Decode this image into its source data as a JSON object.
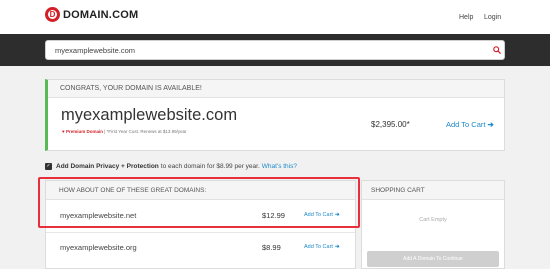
{
  "brand": {
    "logo_letter": "D",
    "name": "DOMAIN.COM",
    "accent": "#d32027"
  },
  "nav": {
    "help": "Help",
    "login": "Login"
  },
  "search": {
    "value": "myexamplewebsite.com",
    "icon": "search-icon"
  },
  "available": {
    "header": "CONGRATS, YOUR DOMAIN IS AVAILABLE!",
    "domain": "myexamplewebsite.com",
    "premium_label": "Premium Domain",
    "premium_note": " | *First Year Cost. Renews at $13.99/year",
    "price": "$2,395.00*",
    "add_to_cart": "Add To Cart",
    "status_color": "#58b956"
  },
  "privacy": {
    "checked": true,
    "bold": "Add Domain Privacy + Protection",
    "text": "to each domain for $8.99 per year.",
    "link": "What's this?"
  },
  "suggestions": {
    "header": "HOW ABOUT ONE OF THESE GREAT DOMAINS:",
    "items": [
      {
        "domain": "myexamplewebsite.net",
        "price": "$12.99",
        "add_to_cart": "Add To Cart"
      },
      {
        "domain": "myexamplewebsite.org",
        "price": "$8.99",
        "add_to_cart": "Add To Cart"
      }
    ]
  },
  "cart": {
    "header": "SHOPPING CART",
    "empty": "Cart Empty",
    "button": "Add A Domain To Continue"
  },
  "colors": {
    "link": "#1d8ac9",
    "highlight": "#e7303b",
    "search_bar": "#2d2d2d"
  }
}
